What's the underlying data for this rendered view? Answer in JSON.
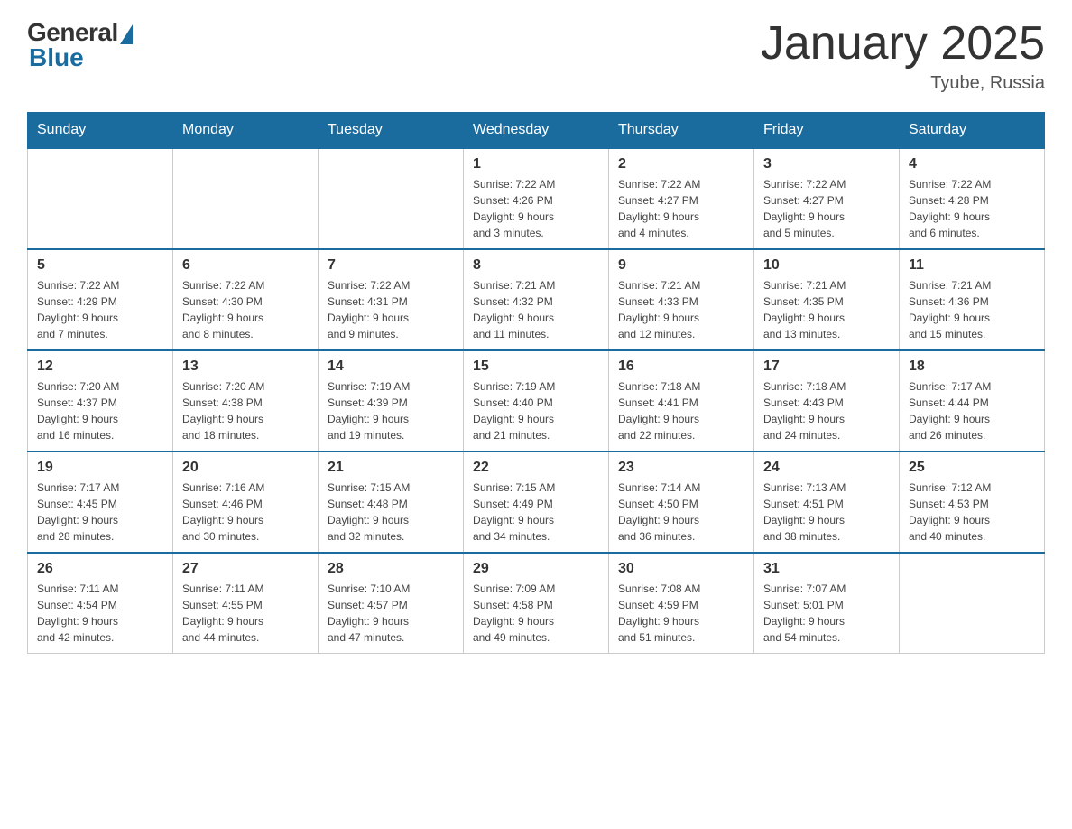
{
  "header": {
    "logo": {
      "general": "General",
      "blue": "Blue"
    },
    "title": "January 2025",
    "location": "Tyube, Russia"
  },
  "weekdays": [
    "Sunday",
    "Monday",
    "Tuesday",
    "Wednesday",
    "Thursday",
    "Friday",
    "Saturday"
  ],
  "weeks": [
    [
      {
        "day": "",
        "info": ""
      },
      {
        "day": "",
        "info": ""
      },
      {
        "day": "",
        "info": ""
      },
      {
        "day": "1",
        "info": "Sunrise: 7:22 AM\nSunset: 4:26 PM\nDaylight: 9 hours\nand 3 minutes."
      },
      {
        "day": "2",
        "info": "Sunrise: 7:22 AM\nSunset: 4:27 PM\nDaylight: 9 hours\nand 4 minutes."
      },
      {
        "day": "3",
        "info": "Sunrise: 7:22 AM\nSunset: 4:27 PM\nDaylight: 9 hours\nand 5 minutes."
      },
      {
        "day": "4",
        "info": "Sunrise: 7:22 AM\nSunset: 4:28 PM\nDaylight: 9 hours\nand 6 minutes."
      }
    ],
    [
      {
        "day": "5",
        "info": "Sunrise: 7:22 AM\nSunset: 4:29 PM\nDaylight: 9 hours\nand 7 minutes."
      },
      {
        "day": "6",
        "info": "Sunrise: 7:22 AM\nSunset: 4:30 PM\nDaylight: 9 hours\nand 8 minutes."
      },
      {
        "day": "7",
        "info": "Sunrise: 7:22 AM\nSunset: 4:31 PM\nDaylight: 9 hours\nand 9 minutes."
      },
      {
        "day": "8",
        "info": "Sunrise: 7:21 AM\nSunset: 4:32 PM\nDaylight: 9 hours\nand 11 minutes."
      },
      {
        "day": "9",
        "info": "Sunrise: 7:21 AM\nSunset: 4:33 PM\nDaylight: 9 hours\nand 12 minutes."
      },
      {
        "day": "10",
        "info": "Sunrise: 7:21 AM\nSunset: 4:35 PM\nDaylight: 9 hours\nand 13 minutes."
      },
      {
        "day": "11",
        "info": "Sunrise: 7:21 AM\nSunset: 4:36 PM\nDaylight: 9 hours\nand 15 minutes."
      }
    ],
    [
      {
        "day": "12",
        "info": "Sunrise: 7:20 AM\nSunset: 4:37 PM\nDaylight: 9 hours\nand 16 minutes."
      },
      {
        "day": "13",
        "info": "Sunrise: 7:20 AM\nSunset: 4:38 PM\nDaylight: 9 hours\nand 18 minutes."
      },
      {
        "day": "14",
        "info": "Sunrise: 7:19 AM\nSunset: 4:39 PM\nDaylight: 9 hours\nand 19 minutes."
      },
      {
        "day": "15",
        "info": "Sunrise: 7:19 AM\nSunset: 4:40 PM\nDaylight: 9 hours\nand 21 minutes."
      },
      {
        "day": "16",
        "info": "Sunrise: 7:18 AM\nSunset: 4:41 PM\nDaylight: 9 hours\nand 22 minutes."
      },
      {
        "day": "17",
        "info": "Sunrise: 7:18 AM\nSunset: 4:43 PM\nDaylight: 9 hours\nand 24 minutes."
      },
      {
        "day": "18",
        "info": "Sunrise: 7:17 AM\nSunset: 4:44 PM\nDaylight: 9 hours\nand 26 minutes."
      }
    ],
    [
      {
        "day": "19",
        "info": "Sunrise: 7:17 AM\nSunset: 4:45 PM\nDaylight: 9 hours\nand 28 minutes."
      },
      {
        "day": "20",
        "info": "Sunrise: 7:16 AM\nSunset: 4:46 PM\nDaylight: 9 hours\nand 30 minutes."
      },
      {
        "day": "21",
        "info": "Sunrise: 7:15 AM\nSunset: 4:48 PM\nDaylight: 9 hours\nand 32 minutes."
      },
      {
        "day": "22",
        "info": "Sunrise: 7:15 AM\nSunset: 4:49 PM\nDaylight: 9 hours\nand 34 minutes."
      },
      {
        "day": "23",
        "info": "Sunrise: 7:14 AM\nSunset: 4:50 PM\nDaylight: 9 hours\nand 36 minutes."
      },
      {
        "day": "24",
        "info": "Sunrise: 7:13 AM\nSunset: 4:51 PM\nDaylight: 9 hours\nand 38 minutes."
      },
      {
        "day": "25",
        "info": "Sunrise: 7:12 AM\nSunset: 4:53 PM\nDaylight: 9 hours\nand 40 minutes."
      }
    ],
    [
      {
        "day": "26",
        "info": "Sunrise: 7:11 AM\nSunset: 4:54 PM\nDaylight: 9 hours\nand 42 minutes."
      },
      {
        "day": "27",
        "info": "Sunrise: 7:11 AM\nSunset: 4:55 PM\nDaylight: 9 hours\nand 44 minutes."
      },
      {
        "day": "28",
        "info": "Sunrise: 7:10 AM\nSunset: 4:57 PM\nDaylight: 9 hours\nand 47 minutes."
      },
      {
        "day": "29",
        "info": "Sunrise: 7:09 AM\nSunset: 4:58 PM\nDaylight: 9 hours\nand 49 minutes."
      },
      {
        "day": "30",
        "info": "Sunrise: 7:08 AM\nSunset: 4:59 PM\nDaylight: 9 hours\nand 51 minutes."
      },
      {
        "day": "31",
        "info": "Sunrise: 7:07 AM\nSunset: 5:01 PM\nDaylight: 9 hours\nand 54 minutes."
      },
      {
        "day": "",
        "info": ""
      }
    ]
  ]
}
